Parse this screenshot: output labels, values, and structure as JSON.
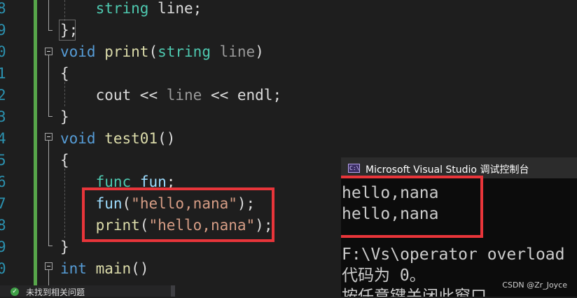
{
  "editor": {
    "line_numbers": [
      "8",
      "9",
      "0",
      "1",
      "2",
      "3",
      "4",
      "5",
      "6",
      "7",
      "8",
      "9",
      "0"
    ],
    "lines": [
      [
        {
          "t": "    "
        },
        {
          "t": "string",
          "c": "ty"
        },
        {
          "t": " line;",
          "c": "pl"
        }
      ],
      [
        {
          "t": "};",
          "c": "pl"
        }
      ],
      [
        {
          "t": "void",
          "c": "kw"
        },
        {
          "t": " "
        },
        {
          "t": "print",
          "c": "fn"
        },
        {
          "t": "(",
          "c": "pl"
        },
        {
          "t": "string",
          "c": "ty"
        },
        {
          "t": " "
        },
        {
          "t": "line",
          "c": "prm"
        },
        {
          "t": ")",
          "c": "pl"
        }
      ],
      [
        {
          "t": "{",
          "c": "pl"
        }
      ],
      [
        {
          "t": "    "
        },
        {
          "t": "cout",
          "c": "pl"
        },
        {
          "t": " << ",
          "c": "pl"
        },
        {
          "t": "line",
          "c": "prm"
        },
        {
          "t": " << ",
          "c": "pl"
        },
        {
          "t": "endl",
          "c": "pl"
        },
        {
          "t": ";",
          "c": "pl"
        }
      ],
      [
        {
          "t": "}",
          "c": "pl"
        }
      ],
      [
        {
          "t": "void",
          "c": "kw"
        },
        {
          "t": " "
        },
        {
          "t": "test01",
          "c": "fn"
        },
        {
          "t": "()",
          "c": "pl"
        }
      ],
      [
        {
          "t": "{",
          "c": "pl"
        }
      ],
      [
        {
          "t": "    "
        },
        {
          "t": "func",
          "c": "ty"
        },
        {
          "t": " "
        },
        {
          "t": "fun",
          "c": "var"
        },
        {
          "t": ";",
          "c": "pl"
        }
      ],
      [
        {
          "t": "    "
        },
        {
          "t": "fun",
          "c": "var"
        },
        {
          "t": "(",
          "c": "pl"
        },
        {
          "t": "\"hello,nana\"",
          "c": "str"
        },
        {
          "t": ");",
          "c": "pl"
        }
      ],
      [
        {
          "t": "    "
        },
        {
          "t": "print",
          "c": "fn"
        },
        {
          "t": "(",
          "c": "pl"
        },
        {
          "t": "\"hello,nana\"",
          "c": "str"
        },
        {
          "t": ");",
          "c": "pl"
        }
      ],
      [
        {
          "t": "}",
          "c": "pl"
        }
      ],
      [
        {
          "t": "int",
          "c": "kw"
        },
        {
          "t": " "
        },
        {
          "t": "main",
          "c": "fn"
        },
        {
          "t": "()",
          "c": "pl"
        }
      ]
    ]
  },
  "console": {
    "title": "Microsoft Visual Studio 调试控制台",
    "icon_text": "C:\\",
    "output": [
      "hello,nana",
      "hello,nana"
    ],
    "path_line": "F:\\Vs\\operator overload",
    "exit_line": "代码为 0。",
    "press_key_line": "按任意键关闭此窗口"
  },
  "watermark": "CSDN @Zr_Joyce",
  "status": {
    "text": "未找到相关问题",
    "icon": "check-icon"
  },
  "colors": {
    "highlight_box": "#e8353a",
    "change_bar": "#57a64a",
    "line_number": "#2b91af"
  }
}
